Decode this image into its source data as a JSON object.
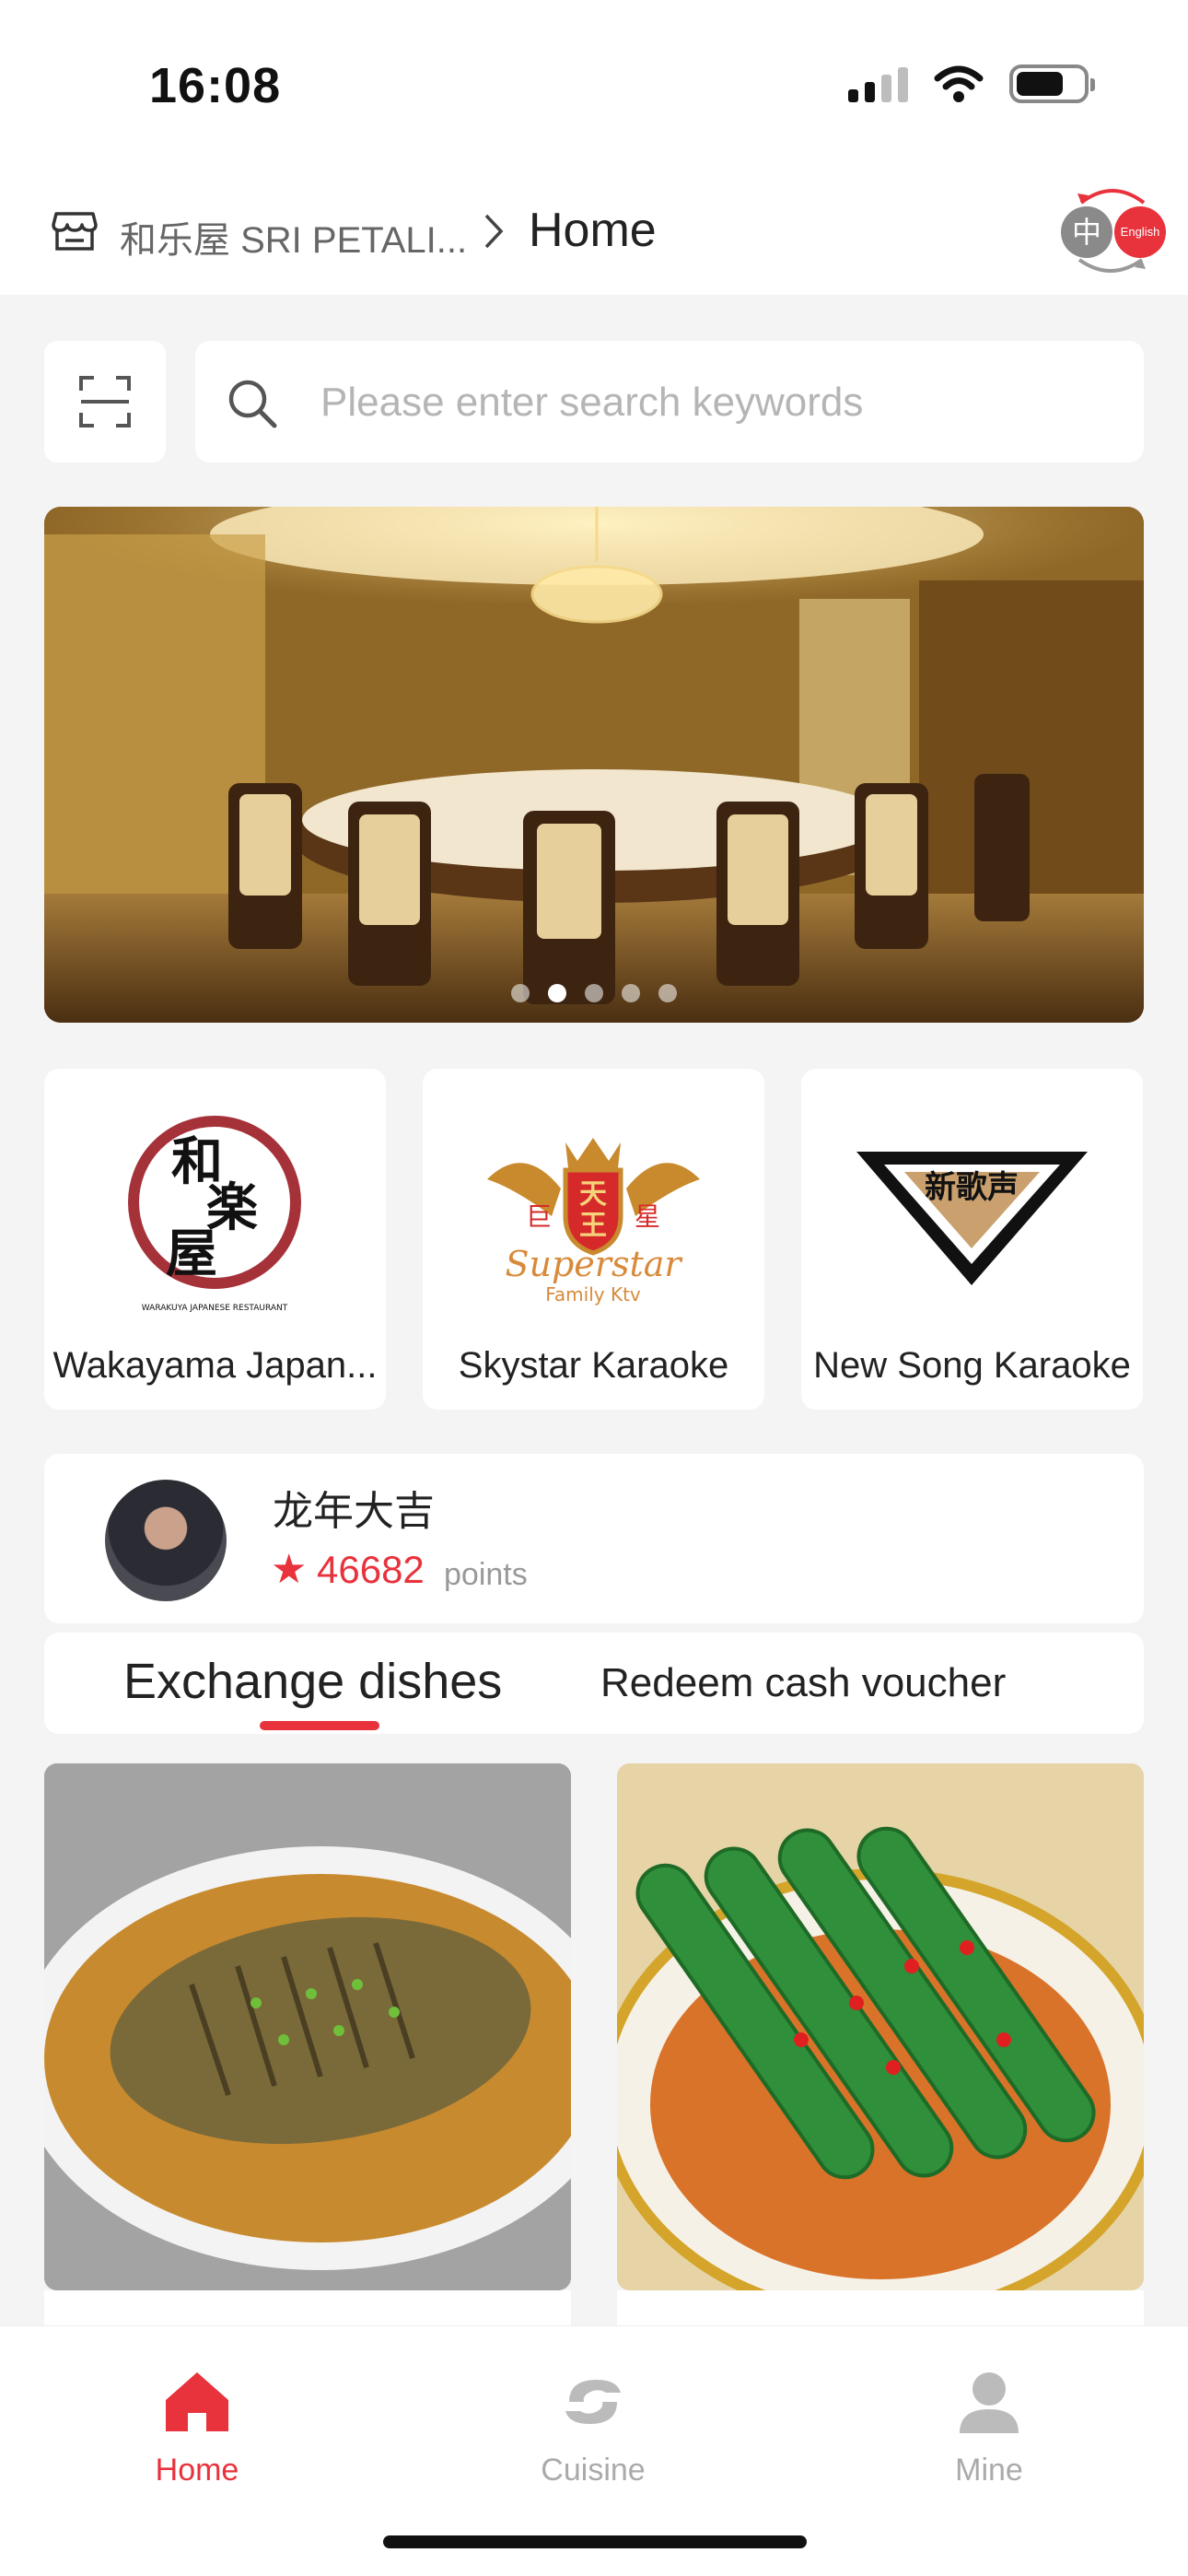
{
  "status_bar": {
    "time": "16:08"
  },
  "header": {
    "store_name": "和乐屋 SRI PETALI...",
    "page_title": "Home"
  },
  "language": {
    "zh": "中",
    "en": "English"
  },
  "search": {
    "placeholder": "Please enter search keywords"
  },
  "banner": {
    "slide_count": 5,
    "active_slide": 2
  },
  "venues": [
    {
      "name": "Wakayama Japan...",
      "logo": "warakuya-logo"
    },
    {
      "name": "Skystar Karaoke",
      "logo": "superstar-family-ktv-logo"
    },
    {
      "name": "New Song Karaoke",
      "logo": "new-song-v-logo"
    }
  ],
  "profile": {
    "name": "龙年大吉",
    "points": "46682",
    "points_unit": "points"
  },
  "tabs": {
    "exchange": "Exchange dishes",
    "redeem": "Redeem cash voucher",
    "active": "exchange"
  },
  "dishes": [
    {
      "image": "braised-fish"
    },
    {
      "image": "okra-with-chili"
    }
  ],
  "tabbar": {
    "home": "Home",
    "cuisine": "Cuisine",
    "mine": "Mine",
    "active": "home"
  },
  "colors": {
    "accent": "#e8323c",
    "inactive": "#aaaaaa"
  },
  "venue_logo_text": {
    "warakuya": [
      "和",
      "楽",
      "屋",
      "WARAKUYA JAPANESE RESTAURANT"
    ],
    "superstar": [
      "天",
      "王",
      "巨",
      "星",
      "Superstar",
      "Family Ktv"
    ],
    "newsong": "新歌声"
  }
}
